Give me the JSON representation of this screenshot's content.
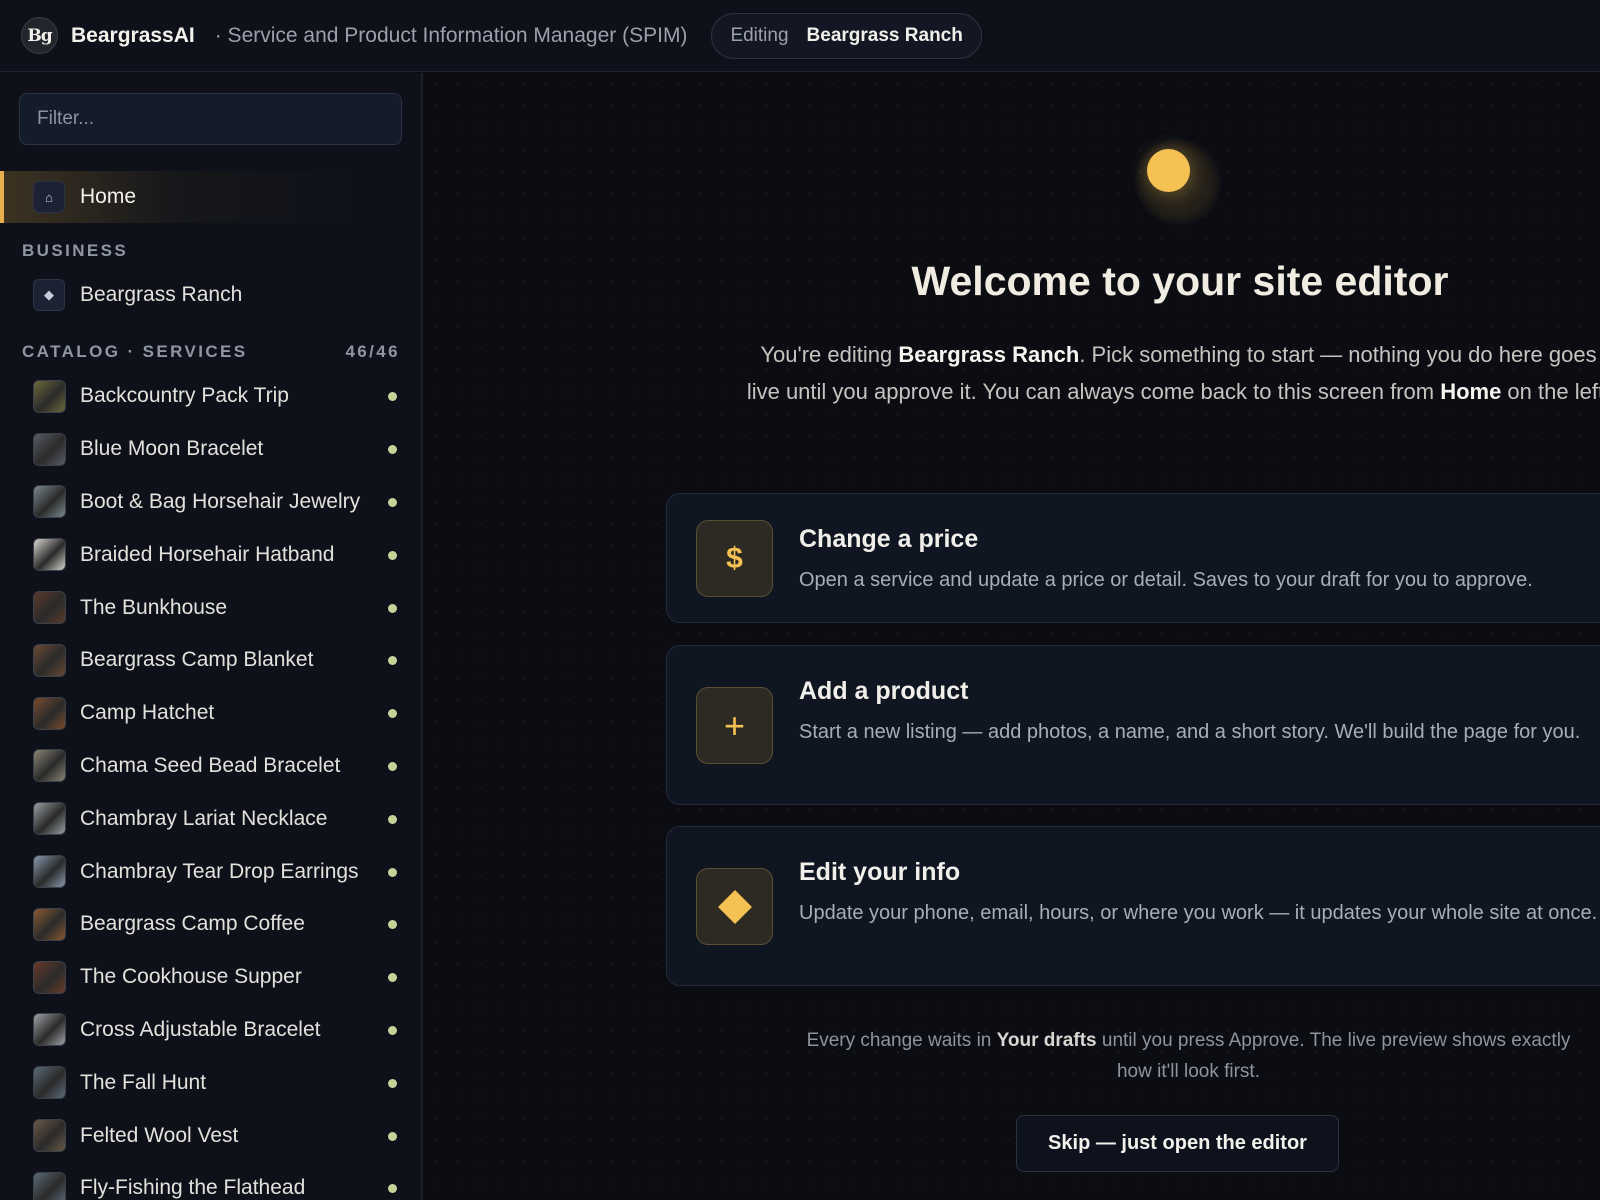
{
  "app": {
    "logo_text": "Bg",
    "brand": "BeargrassAI",
    "subtitle": "· Service and Product Information Manager (SPIM)",
    "editing_label": "Editing",
    "editing_value": "Beargrass Ranch"
  },
  "sidebar": {
    "filter_placeholder": "Filter...",
    "home": {
      "label": "Home",
      "icon": "home-icon"
    },
    "business_header": "BUSINESS",
    "business_item": {
      "label": "Beargrass Ranch",
      "icon": "diamond-icon"
    },
    "catalog_header": "CATALOG · SERVICES",
    "catalog_count": "46/46",
    "status_color": "#c4d59a",
    "services": [
      {
        "label": "Backcountry Pack Trip",
        "thumb": "#6d6a3c"
      },
      {
        "label": "Blue Moon Bracelet",
        "thumb": "#5a5c66"
      },
      {
        "label": "Boot & Bag Horsehair Jewelry",
        "thumb": "#7a8a8f"
      },
      {
        "label": "Braided Horsehair Hatband",
        "thumb": "#d8d6d0"
      },
      {
        "label": "The Bunkhouse",
        "thumb": "#5a3a2a"
      },
      {
        "label": "Beargrass Camp Blanket",
        "thumb": "#6a4a34"
      },
      {
        "label": "Camp Hatchet",
        "thumb": "#7a4a2e"
      },
      {
        "label": "Chama Seed Bead Bracelet",
        "thumb": "#8a8676"
      },
      {
        "label": "Chambray Lariat Necklace",
        "thumb": "#9aa0a4"
      },
      {
        "label": "Chambray Tear Drop Earrings",
        "thumb": "#8a9aae"
      },
      {
        "label": "Beargrass Camp Coffee",
        "thumb": "#8a5a32"
      },
      {
        "label": "The Cookhouse Supper",
        "thumb": "#6a3a2a"
      },
      {
        "label": "Cross Adjustable Bracelet",
        "thumb": "#a0a2a6"
      },
      {
        "label": "The Fall Hunt",
        "thumb": "#5a6a7a"
      },
      {
        "label": "Felted Wool Vest",
        "thumb": "#6a5a48"
      },
      {
        "label": "Fly-Fishing the Flathead",
        "thumb": "#5a6a78"
      }
    ]
  },
  "main": {
    "title": "Welcome to your site editor",
    "intro": {
      "p1": "You're editing ",
      "b1": "Beargrass Ranch",
      "p2": ". Pick something to start — nothing you do here goes live until you approve it. You can always come back to this screen from ",
      "b2": "Home",
      "p3": " on the left."
    },
    "cards": [
      {
        "icon": "dollar-icon",
        "glyph": "$",
        "title": "Change a price",
        "desc": "Open a service and update a price or detail. Saves to your draft for you to approve."
      },
      {
        "icon": "plus-icon",
        "glyph": "+",
        "title": "Add a product",
        "desc": "Start a new listing — add photos, a name, and a short story. We'll build the page for you."
      },
      {
        "icon": "diamond-icon",
        "glyph": "",
        "title": "Edit your info",
        "desc": "Update your phone, email, hours, or where you work — it updates your whole site at once."
      }
    ],
    "footnote": {
      "p1": "Every change waits in ",
      "b1": "Your drafts",
      "p2": " until you press Approve. The live preview shows exactly how it'll look first."
    },
    "skip_label": "Skip — just open the editor"
  }
}
